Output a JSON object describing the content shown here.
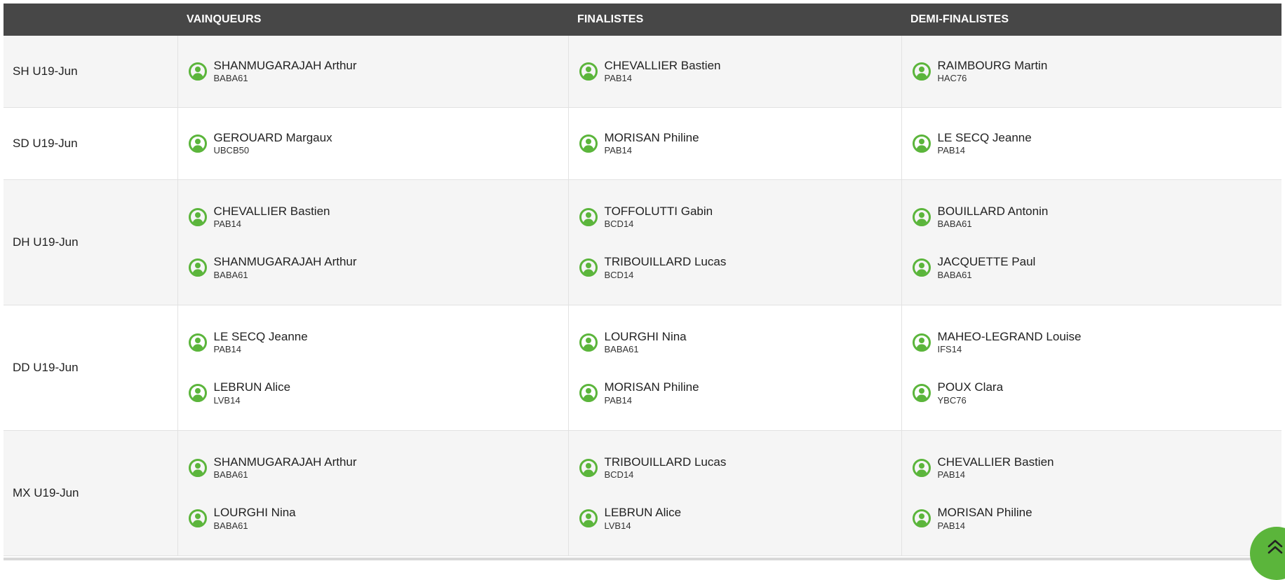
{
  "table": {
    "headers": {
      "category": "",
      "winners": "VAINQUEURS",
      "finalists": "FINALISTES",
      "semifinalists": "DEMI-FINALISTES"
    },
    "rows": [
      {
        "category": "SH U19-Jun",
        "winners": [
          {
            "name": "SHANMUGARAJAH Arthur",
            "club": "BABA61"
          }
        ],
        "finalists": [
          {
            "name": "CHEVALLIER Bastien",
            "club": "PAB14"
          }
        ],
        "semifinalists": [
          {
            "name": "RAIMBOURG Martin",
            "club": "HAC76"
          }
        ]
      },
      {
        "category": "SD U19-Jun",
        "winners": [
          {
            "name": "GEROUARD Margaux",
            "club": "UBCB50"
          }
        ],
        "finalists": [
          {
            "name": "MORISAN Philine",
            "club": "PAB14"
          }
        ],
        "semifinalists": [
          {
            "name": "LE SECQ Jeanne",
            "club": "PAB14"
          }
        ]
      },
      {
        "category": "DH U19-Jun",
        "winners": [
          {
            "name": "CHEVALLIER Bastien",
            "club": "PAB14"
          },
          {
            "name": "SHANMUGARAJAH Arthur",
            "club": "BABA61"
          }
        ],
        "finalists": [
          {
            "name": "TOFFOLUTTI Gabin",
            "club": "BCD14"
          },
          {
            "name": "TRIBOUILLARD Lucas",
            "club": "BCD14"
          }
        ],
        "semifinalists": [
          {
            "name": "BOUILLARD Antonin",
            "club": "BABA61"
          },
          {
            "name": "JACQUETTE Paul",
            "club": "BABA61"
          }
        ]
      },
      {
        "category": "DD U19-Jun",
        "winners": [
          {
            "name": "LE SECQ Jeanne",
            "club": "PAB14"
          },
          {
            "name": "LEBRUN Alice",
            "club": "LVB14"
          }
        ],
        "finalists": [
          {
            "name": "LOURGHI Nina",
            "club": "BABA61"
          },
          {
            "name": "MORISAN Philine",
            "club": "PAB14"
          }
        ],
        "semifinalists": [
          {
            "name": "MAHEO-LEGRAND Louise",
            "club": "IFS14"
          },
          {
            "name": "POUX Clara",
            "club": "YBC76"
          }
        ]
      },
      {
        "category": "MX U19-Jun",
        "winners": [
          {
            "name": "SHANMUGARAJAH Arthur",
            "club": "BABA61"
          },
          {
            "name": "LOURGHI Nina",
            "club": "BABA61"
          }
        ],
        "finalists": [
          {
            "name": "TRIBOUILLARD Lucas",
            "club": "BCD14"
          },
          {
            "name": "LEBRUN Alice",
            "club": "LVB14"
          }
        ],
        "semifinalists": [
          {
            "name": "CHEVALLIER Bastien",
            "club": "PAB14"
          },
          {
            "name": "MORISAN Philine",
            "club": "PAB14"
          }
        ]
      }
    ]
  },
  "icons": {
    "player": "user-circle-icon",
    "scroll_top": "double-chevron-up-icon"
  },
  "colors": {
    "accent": "#5bb53b",
    "header_bg": "#474747",
    "header_text": "#ffffff",
    "row_alt": "#f5f5f5"
  }
}
